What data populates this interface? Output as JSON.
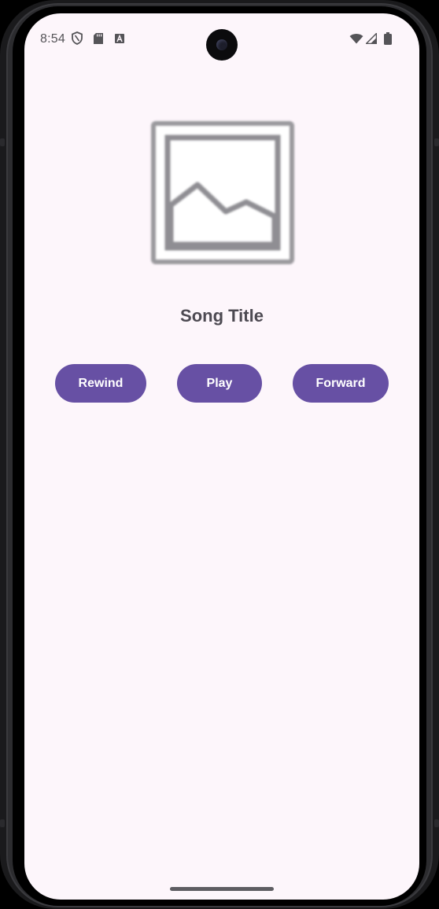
{
  "status_bar": {
    "time": "8:54",
    "icons": [
      "shield-icon",
      "sd-card-icon",
      "font-a-icon",
      "wifi-icon",
      "signal-icon",
      "battery-icon"
    ]
  },
  "player": {
    "album_art_icon": "image-placeholder-icon",
    "song_title": "Song Title",
    "controls": {
      "rewind_label": "Rewind",
      "play_label": "Play",
      "forward_label": "Forward"
    }
  },
  "colors": {
    "primary": "#6750a4",
    "background": "#fdf6fb",
    "on_primary": "#ffffff",
    "title_text": "#4d4a52"
  }
}
